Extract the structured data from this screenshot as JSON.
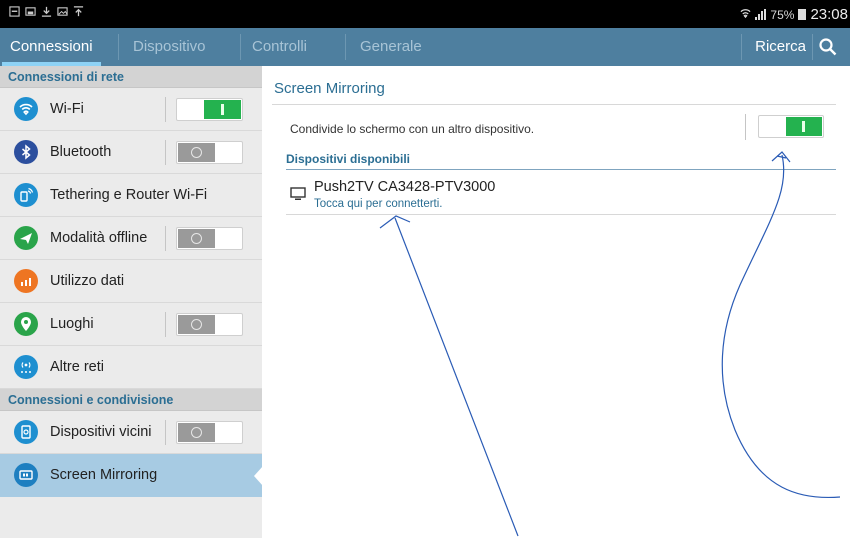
{
  "status_bar": {
    "left_icons": [
      "notification-icon",
      "screenshot-icon",
      "download-icon",
      "gallery-icon",
      "upload-icon"
    ],
    "battery": "75%",
    "time": "23:08"
  },
  "tabs": [
    {
      "label": "Connessioni",
      "active": true
    },
    {
      "label": "Dispositivo",
      "active": false
    },
    {
      "label": "Controlli",
      "active": false
    },
    {
      "label": "Generale",
      "active": false
    }
  ],
  "search": {
    "label": "Ricerca",
    "icon": "search-icon"
  },
  "sidebar": {
    "section1": "Connessioni di rete",
    "section2": "Connessioni e condivisione",
    "items": [
      {
        "label": "Wi-Fi",
        "icon": "wifi-icon",
        "icon_color": "#1e8fd0",
        "toggle": "on"
      },
      {
        "label": "Bluetooth",
        "icon": "bluetooth-icon",
        "icon_color": "#2c4f9e",
        "toggle": "off"
      },
      {
        "label": "Tethering e Router Wi-Fi",
        "icon": "tethering-icon",
        "icon_color": "#1e8fd0",
        "toggle": null
      },
      {
        "label": "Modalità offline",
        "icon": "airplane-icon",
        "icon_color": "#2aa44a",
        "toggle": "off"
      },
      {
        "label": "Utilizzo dati",
        "icon": "data-usage-icon",
        "icon_color": "#ee7522",
        "toggle": null
      },
      {
        "label": "Luoghi",
        "icon": "location-icon",
        "icon_color": "#2aa44a",
        "toggle": "off"
      },
      {
        "label": "Altre reti",
        "icon": "more-networks-icon",
        "icon_color": "#1e8fd0",
        "toggle": null
      },
      {
        "label": "Dispositivi vicini",
        "icon": "nearby-devices-icon",
        "icon_color": "#1e8fd0",
        "toggle": "off"
      },
      {
        "label": "Screen Mirroring",
        "icon": "screen-mirroring-icon",
        "icon_color": "#1e7fc0",
        "toggle": null,
        "selected": true
      }
    ]
  },
  "main": {
    "title": "Screen Mirroring",
    "share_text": "Condivide lo schermo con un altro dispositivo.",
    "share_toggle": "on",
    "available_header": "Dispositivi disponibili",
    "devices": [
      {
        "name": "Push2TV CA3428-PTV3000",
        "subtitle": "Tocca qui per connetterti.",
        "icon": "monitor-icon"
      }
    ]
  },
  "colors": {
    "tabbar": "#4e7f9f",
    "accent_text": "#2b6e93",
    "toggle_on": "#24b24f",
    "toggle_off": "#9a9a9a",
    "selected_item": "#a7cbe3",
    "annotation": "#2a5bb5"
  }
}
